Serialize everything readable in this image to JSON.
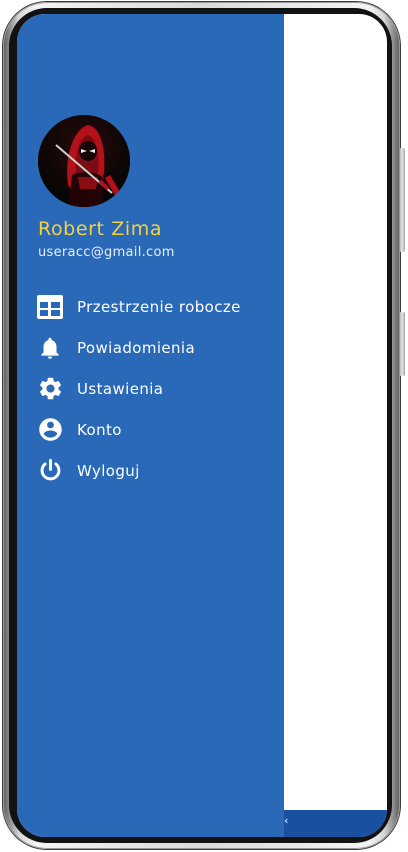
{
  "profile": {
    "name": "Robert Zima",
    "email": "useracc@gmail.com",
    "name_color": "#f4d23e"
  },
  "menu": {
    "items": [
      {
        "label": "Przestrzenie robocze",
        "icon": "table-grid-icon"
      },
      {
        "label": "Powiadomienia",
        "icon": "bell-icon"
      },
      {
        "label": "Ustawienia",
        "icon": "gear-icon"
      },
      {
        "label": "Konto",
        "icon": "account-circle-icon"
      },
      {
        "label": "Wyloguj",
        "icon": "power-icon"
      }
    ]
  },
  "bottom_bar": {
    "back_glyph": "‹"
  },
  "colors": {
    "drawer": "#2a68b8",
    "bottom_bar": "#1950a0",
    "content": "#ffffff"
  }
}
